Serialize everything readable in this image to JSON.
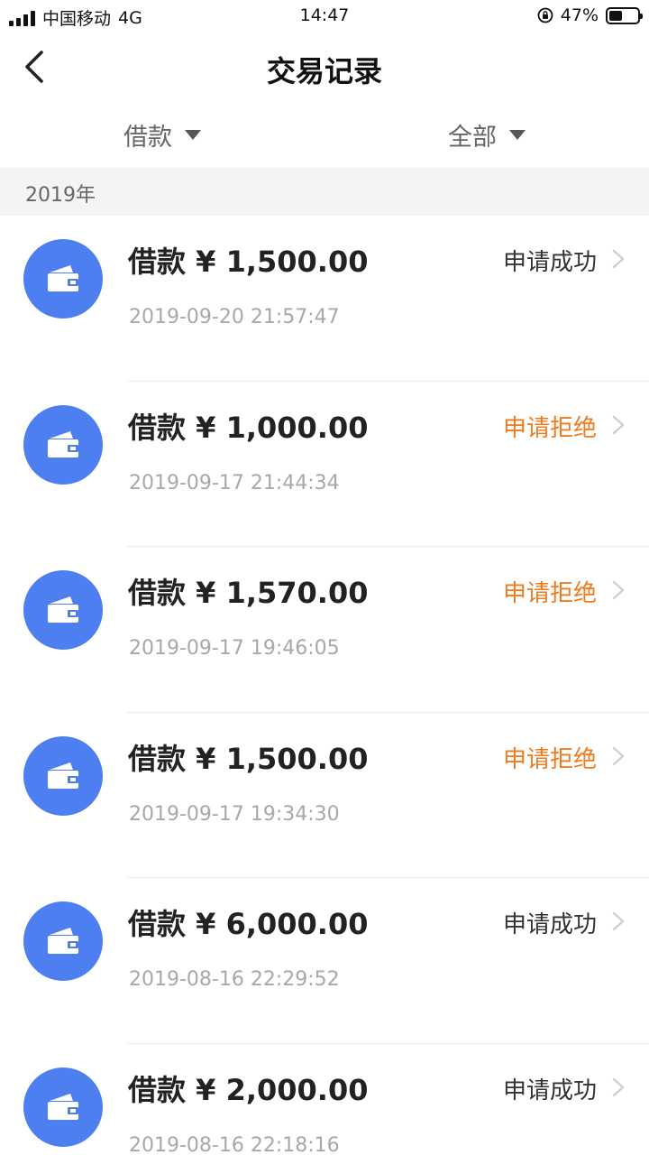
{
  "status_bar": {
    "carrier": "中国移动",
    "network": "4G",
    "time": "14:47",
    "battery": "47%",
    "battery_level": 0.47
  },
  "nav": {
    "title": "交易记录",
    "back_icon": "chevron-left-icon"
  },
  "filters": {
    "type": "借款",
    "status": "全部"
  },
  "year": "2019年",
  "colors": {
    "accent": "#4d7ff0",
    "success_text": "#333333",
    "rejected_text": "#f07a1c"
  },
  "records": [
    {
      "type": "借款",
      "amount": "¥ 1,500.00",
      "date": "2019-09-20 21:57:47",
      "status": "申请成功",
      "state": "success"
    },
    {
      "type": "借款",
      "amount": "¥ 1,000.00",
      "date": "2019-09-17 21:44:34",
      "status": "申请拒绝",
      "state": "rejected"
    },
    {
      "type": "借款",
      "amount": "¥ 1,570.00",
      "date": "2019-09-17 19:46:05",
      "status": "申请拒绝",
      "state": "rejected"
    },
    {
      "type": "借款",
      "amount": "¥ 1,500.00",
      "date": "2019-09-17 19:34:30",
      "status": "申请拒绝",
      "state": "rejected"
    },
    {
      "type": "借款",
      "amount": "¥ 6,000.00",
      "date": "2019-08-16 22:29:52",
      "status": "申请成功",
      "state": "success"
    },
    {
      "type": "借款",
      "amount": "¥ 2,000.00",
      "date": "2019-08-16 22:18:16",
      "status": "申请成功",
      "state": "success"
    }
  ]
}
